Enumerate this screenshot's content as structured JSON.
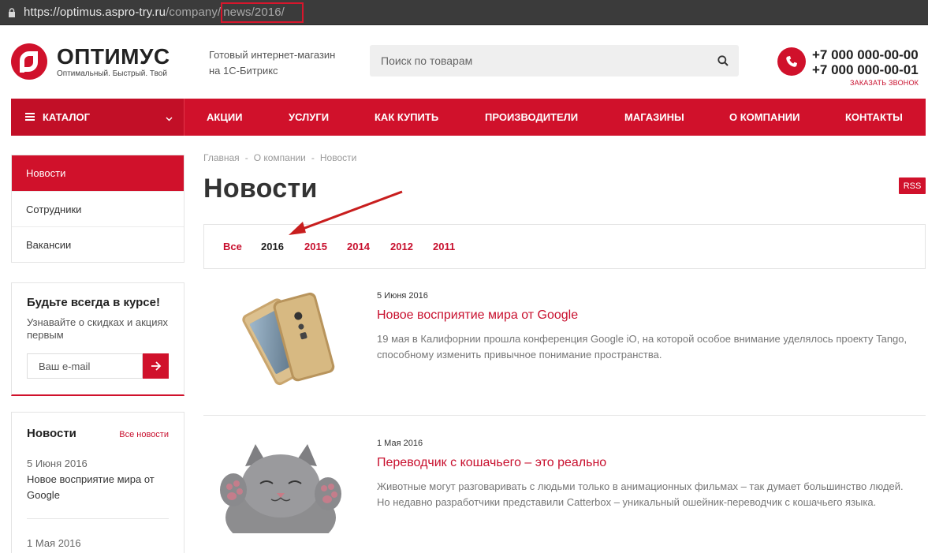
{
  "browser": {
    "url_host": "https://optimus.aspro-try.ru",
    "url_path": "/company/",
    "url_highlight": "news/2016/"
  },
  "header": {
    "logo_name": "ОПТИМУС",
    "logo_slogan": "Оптимальный. Быстрый. Твой",
    "tagline_1": "Готовый интернет-магазин",
    "tagline_2": "на 1С-Битрикс",
    "search_placeholder": "Поиск по товарам",
    "phone_1": "+7 000 000-00-00",
    "phone_2": "+7 000 000-00-01",
    "callback": "ЗАКАЗАТЬ ЗВОНОК"
  },
  "nav": {
    "catalog": "КАТАЛОГ",
    "items": [
      "АКЦИИ",
      "УСЛУГИ",
      "КАК КУПИТЬ",
      "ПРОИЗВОДИТЕЛИ",
      "МАГАЗИНЫ",
      "О КОМПАНИИ",
      "КОНТАКТЫ"
    ]
  },
  "sidebar": {
    "menu": [
      "Новости",
      "Сотрудники",
      "Вакансии"
    ],
    "subscribe_title": "Будьте всегда в курсе!",
    "subscribe_text": "Узнавайте о скидках и акциях первым",
    "email_placeholder": "Ваш e-mail",
    "news_title": "Новости",
    "news_all": "Все новости",
    "news": [
      {
        "date": "5 Июня 2016",
        "title": "Новое восприятие мира от Google"
      },
      {
        "date": "1 Мая 2016",
        "title": ""
      }
    ]
  },
  "main": {
    "breadcrumb": [
      "Главная",
      "О компании",
      "Новости"
    ],
    "breadcrumb_sep": "-",
    "title": "Новости",
    "rss": "RSS",
    "years": [
      "Все",
      "2016",
      "2015",
      "2014",
      "2012",
      "2011"
    ],
    "news": [
      {
        "date": "5 Июня 2016",
        "title": "Новое восприятие мира от Google",
        "text": "19 мая в Калифорнии прошла конференция Google iO, на которой особое внимание уделялось проекту Tango, способному изменить привычное понимание пространства."
      },
      {
        "date": "1 Мая 2016",
        "title": "Переводчик с кошачьего – это реально",
        "text": "Животные могут разговаривать с людьми только в анимационных фильмах – так думает большинство людей. Но недавно разработчики представили Catterbox – уникальный ошейник-переводчик с кошачьего языка."
      }
    ]
  },
  "colors": {
    "brand": "#d0112b",
    "link": "#c8102e"
  }
}
